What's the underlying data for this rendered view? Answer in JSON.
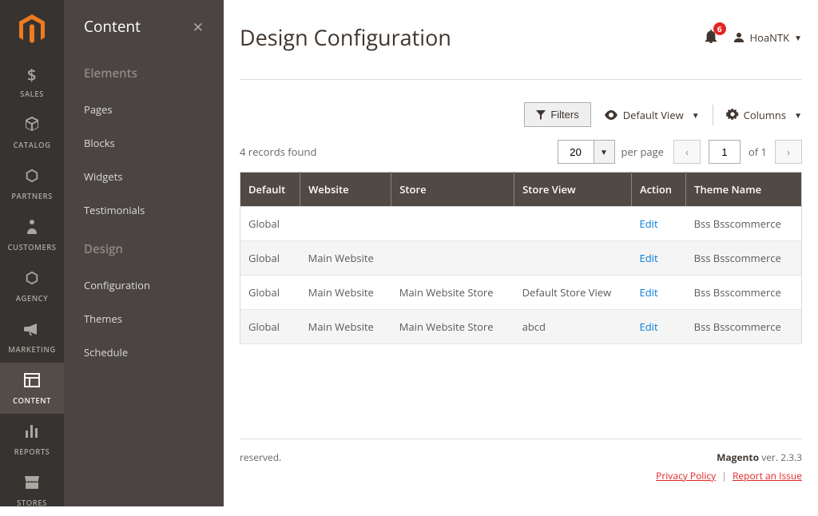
{
  "sidebar": {
    "items": [
      {
        "label": "SALES",
        "icon": "dollar"
      },
      {
        "label": "CATALOG",
        "icon": "cube"
      },
      {
        "label": "PARTNERS",
        "icon": "hex"
      },
      {
        "label": "CUSTOMERS",
        "icon": "person"
      },
      {
        "label": "AGENCY",
        "icon": "hex"
      },
      {
        "label": "MARKETING",
        "icon": "megaphone"
      },
      {
        "label": "CONTENT",
        "icon": "layout"
      },
      {
        "label": "REPORTS",
        "icon": "bars"
      },
      {
        "label": "STORES",
        "icon": "storefront"
      }
    ],
    "active_index": 6
  },
  "flyout": {
    "title": "Content",
    "sections": [
      {
        "title": "Elements",
        "links": [
          "Pages",
          "Blocks",
          "Widgets",
          "Testimonials"
        ]
      },
      {
        "title": "Design",
        "links": [
          "Configuration",
          "Themes",
          "Schedule"
        ]
      }
    ]
  },
  "header": {
    "page_title": "Design Configuration",
    "notif_count": "6",
    "user_name": "HoaNTK"
  },
  "toolbar": {
    "filters_label": "Filters",
    "default_view_label": "Default View",
    "columns_label": "Columns",
    "records_found": "4 records found",
    "page_size": "20",
    "per_page_label": "per page",
    "current_page": "1",
    "of_label": "of 1"
  },
  "table": {
    "columns": [
      "Default",
      "Website",
      "Store",
      "Store View",
      "Action",
      "Theme Name"
    ],
    "rows": [
      {
        "default": "Global",
        "website": "",
        "store": "",
        "store_view": "",
        "action": "Edit",
        "theme": "Bss Bsscommerce"
      },
      {
        "default": "Global",
        "website": "Main Website",
        "store": "",
        "store_view": "",
        "action": "Edit",
        "theme": "Bss Bsscommerce"
      },
      {
        "default": "Global",
        "website": "Main Website",
        "store": "Main Website Store",
        "store_view": "Default Store View",
        "action": "Edit",
        "theme": "Bss Bsscommerce"
      },
      {
        "default": "Global",
        "website": "Main Website",
        "store": "Main Website Store",
        "store_view": "abcd",
        "action": "Edit",
        "theme": "Bss Bsscommerce"
      }
    ]
  },
  "footer": {
    "reserved_fragment": "reserved.",
    "brand": "Magento",
    "version": " ver. 2.3.3",
    "privacy": "Privacy Policy",
    "report": "Report an Issue"
  }
}
